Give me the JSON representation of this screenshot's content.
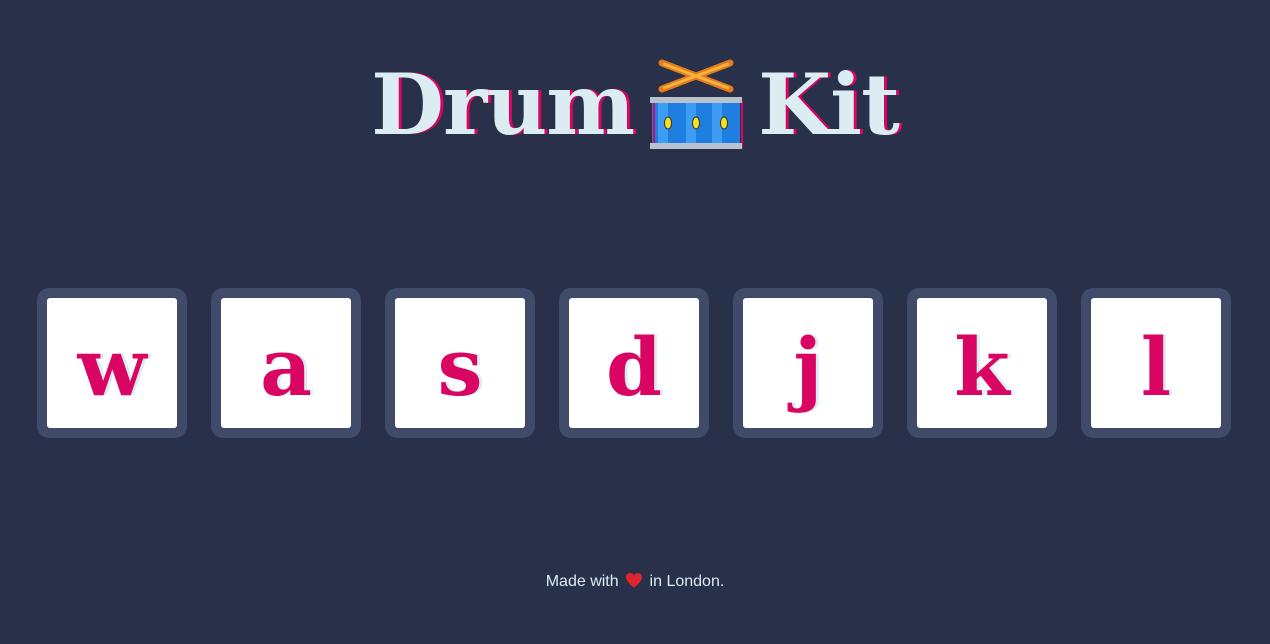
{
  "header": {
    "title_left": "Drum",
    "title_icon": "drum-icon",
    "title_right": "Kit"
  },
  "drum_keys": [
    {
      "letter": "w"
    },
    {
      "letter": "a"
    },
    {
      "letter": "s"
    },
    {
      "letter": "d"
    },
    {
      "letter": "j"
    },
    {
      "letter": "k"
    },
    {
      "letter": "l"
    }
  ],
  "footer": {
    "prefix": "Made with",
    "icon": "heart-icon",
    "suffix": "in London."
  },
  "colors": {
    "background": "#283149",
    "key_frame": "#404B69",
    "accent": "#DA0463",
    "light": "#DBEDF3"
  }
}
